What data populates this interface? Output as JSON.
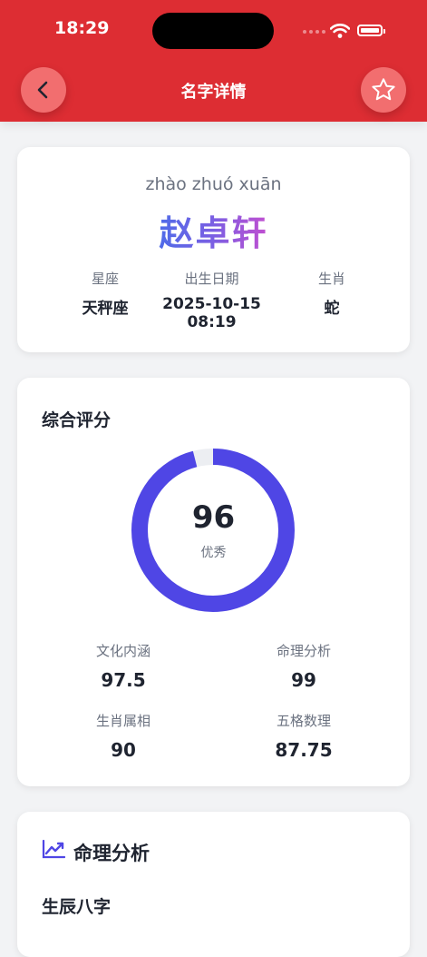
{
  "status_bar": {
    "time": "18:29"
  },
  "header": {
    "title": "名字详情"
  },
  "name_card": {
    "pinyin": "zhào zhuó xuān",
    "name": "赵卓轩",
    "info": [
      {
        "label": "星座",
        "value": "天秤座"
      },
      {
        "label": "出生日期",
        "value": "2025-10-15 08:19"
      },
      {
        "label": "生肖",
        "value": "蛇"
      }
    ]
  },
  "score_card": {
    "title": "综合评分",
    "score": "96",
    "score_fraction": 0.96,
    "level": "优秀",
    "metrics": [
      {
        "label": "文化内涵",
        "value": "97.5"
      },
      {
        "label": "命理分析",
        "value": "99"
      },
      {
        "label": "生肖属相",
        "value": "90"
      },
      {
        "label": "五格数理",
        "value": "87.75"
      }
    ]
  },
  "analysis_card": {
    "title": "命理分析",
    "subtitle": "生辰八字"
  },
  "colors": {
    "header": "#dd2d33",
    "button": "#f26e6f",
    "ring": "#4f46e5",
    "ring_track": "#eceef2"
  },
  "icons": {
    "back": "chevron-left-icon",
    "favorite": "star-outline-icon",
    "analysis": "trending-chart-icon"
  }
}
